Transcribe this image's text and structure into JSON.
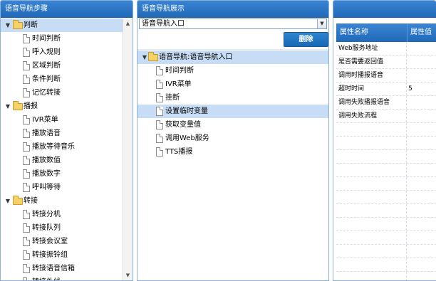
{
  "left": {
    "title": "语音导航步骤",
    "groups": [
      {
        "label": "判断",
        "children": [
          "时间判断",
          "呼入规则",
          "区域判断",
          "条件判断",
          "记忆转接"
        ]
      },
      {
        "label": "播报",
        "children": [
          "IVR菜单",
          "播放语音",
          "播放等待音乐",
          "播放数值",
          "播放数字",
          "呼叫等待"
        ]
      },
      {
        "label": "转接",
        "children": [
          "转接分机",
          "转接队列",
          "转接会议室",
          "转接振铃组",
          "转接语音信箱",
          "转接外线"
        ]
      }
    ],
    "toggle_glyph": "▼"
  },
  "middle": {
    "title": "语音导航展示",
    "select_value": "语音导航入口",
    "delete_label": "删除",
    "root_label": "语音导航:语音导航入口",
    "children": [
      "时间判断",
      "IVR菜单",
      "挂断",
      "设置临时变量",
      "获取变量值",
      "调用Web服务",
      "TTS播报"
    ],
    "selected_index": 3
  },
  "right": {
    "col_name": "属性名称",
    "col_value": "属性值",
    "rows": [
      {
        "name": "Web服务地址",
        "value": ""
      },
      {
        "name": "是否需要返回值",
        "value": ""
      },
      {
        "name": "调用时播报语音",
        "value": ""
      },
      {
        "name": "超时时间",
        "value": "5"
      },
      {
        "name": "调用失败播报语音",
        "value": ""
      },
      {
        "name": "调用失败流程",
        "value": ""
      }
    ],
    "empty_rows": 12
  }
}
